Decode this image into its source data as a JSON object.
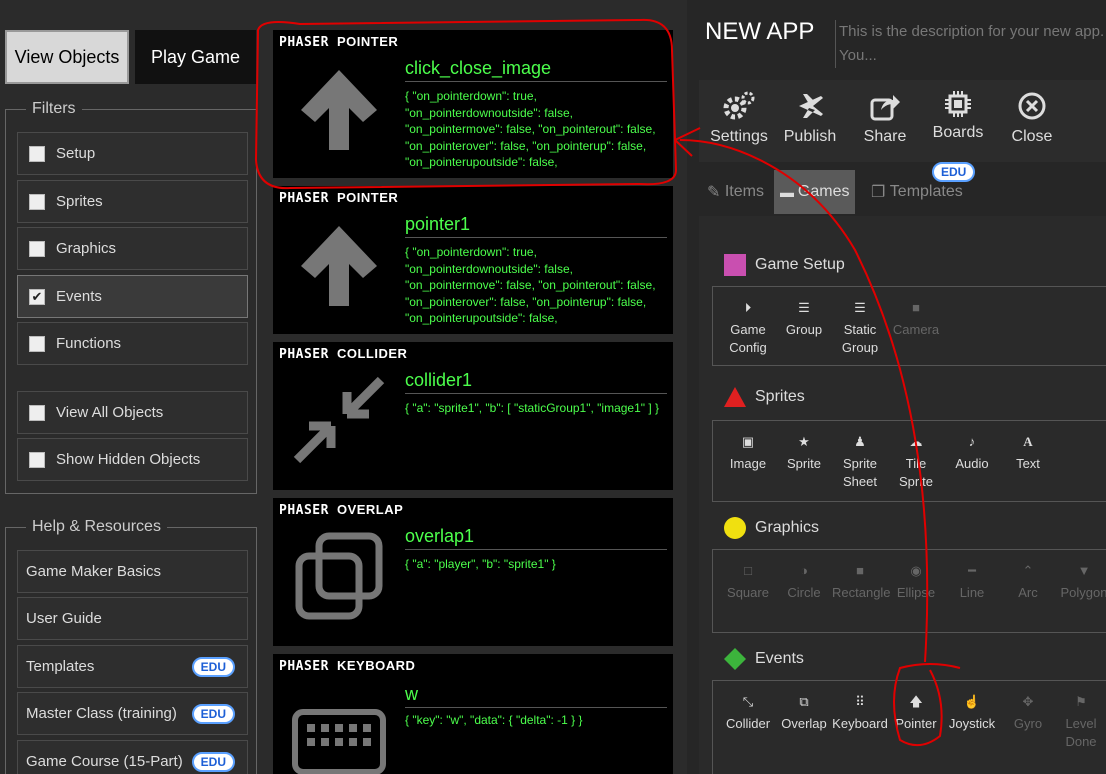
{
  "left": {
    "view_objects": "View Objects",
    "play_game": "Play Game",
    "filters_legend": "Filters",
    "filters": [
      {
        "label": "Setup",
        "checked": false
      },
      {
        "label": "Sprites",
        "checked": false
      },
      {
        "label": "Graphics",
        "checked": false
      },
      {
        "label": "Events",
        "checked": true
      },
      {
        "label": "Functions",
        "checked": false
      }
    ],
    "view_all": "View All Objects",
    "show_hidden": "Show Hidden Objects",
    "help_legend": "Help & Resources",
    "help": [
      {
        "label": "Game Maker Basics",
        "badge": ""
      },
      {
        "label": "User Guide",
        "badge": ""
      },
      {
        "label": "Templates",
        "badge": "EDU"
      },
      {
        "label": "Master Class (training)",
        "badge": "EDU"
      },
      {
        "label": "Game Course (15-Part)",
        "badge": "EDU"
      }
    ],
    "check_mark": "✔"
  },
  "cards": [
    {
      "brand": "PHASER",
      "type": "POINTER",
      "icon": "arrow-up-icon",
      "name": "click_close_image",
      "props": "{ \"on_pointerdown\": true, \"on_pointerdownoutside\": false, \"on_pointermove\": false, \"on_pointerout\": false, \"on_pointerover\": false, \"on_pointerup\": false, \"on_pointerupoutside\": false,"
    },
    {
      "brand": "PHASER",
      "type": "POINTER",
      "icon": "arrow-up-icon",
      "name": "pointer1",
      "props": "{ \"on_pointerdown\": true, \"on_pointerdownoutside\": false, \"on_pointermove\": false, \"on_pointerout\": false, \"on_pointerover\": false, \"on_pointerup\": false, \"on_pointerupoutside\": false,"
    },
    {
      "brand": "PHASER",
      "type": "COLLIDER",
      "icon": "collide-arrows-icon",
      "name": "collider1",
      "props": "{ \"a\": \"sprite1\", \"b\": [ \"staticGroup1\", \"image1\" ] }"
    },
    {
      "brand": "PHASER",
      "type": "OVERLAP",
      "icon": "overlap-squares-icon",
      "name": "overlap1",
      "props": "{ \"a\": \"player\", \"b\": \"sprite1\" }"
    },
    {
      "brand": "PHASER",
      "type": "KEYBOARD",
      "icon": "keyboard-icon",
      "name": "w",
      "props": "{ \"key\": \"w\", \"data\": { \"delta\": -1 } }"
    }
  ],
  "right": {
    "app_title": "NEW APP",
    "app_desc": "This is the description for your new app. You...",
    "toolbar": [
      {
        "label": "Settings",
        "icon": "gears-icon"
      },
      {
        "label": "Publish",
        "icon": "plane-icon"
      },
      {
        "label": "Share",
        "icon": "share-icon"
      },
      {
        "label": "Boards",
        "icon": "chip-icon"
      },
      {
        "label": "Close",
        "icon": "close-circle-icon"
      }
    ],
    "tabs": [
      {
        "label": "Items",
        "icon": "edit-icon"
      },
      {
        "label": "Games",
        "icon": "gamepad-icon"
      },
      {
        "label": "Templates",
        "icon": "copy-icon"
      }
    ],
    "tabs_badge": "EDU",
    "sections": [
      {
        "title": "Game Setup",
        "color": "#c94fb0",
        "items": [
          {
            "label": "Game Config",
            "icon": "play-circle-icon",
            "disabled": false
          },
          {
            "label": "Group",
            "icon": "list-icon",
            "disabled": false
          },
          {
            "label": "Static Group",
            "icon": "list-icon",
            "disabled": false
          },
          {
            "label": "Camera",
            "icon": "camera-icon",
            "disabled": true
          }
        ]
      },
      {
        "title": "Sprites",
        "color": "#e02020",
        "items": [
          {
            "label": "Image",
            "icon": "picture-icon",
            "disabled": false
          },
          {
            "label": "Sprite",
            "icon": "star-icon",
            "disabled": false
          },
          {
            "label": "Sprite Sheet",
            "icon": "users-icon",
            "disabled": false
          },
          {
            "label": "Tile Sprite",
            "icon": "cloud-icon",
            "disabled": false
          },
          {
            "label": "Audio",
            "icon": "volume-icon",
            "disabled": false
          },
          {
            "label": "Text",
            "icon": "text-icon",
            "disabled": false
          }
        ]
      },
      {
        "title": "Graphics",
        "color": "#f0e010",
        "items": [
          {
            "label": "Square",
            "icon": "square-icon",
            "disabled": true
          },
          {
            "label": "Circle",
            "icon": "half-circle-icon",
            "disabled": true
          },
          {
            "label": "Rectangle",
            "icon": "square-filled-icon",
            "disabled": true
          },
          {
            "label": "Ellipse",
            "icon": "eye-icon",
            "disabled": true
          },
          {
            "label": "Line",
            "icon": "minus-icon",
            "disabled": true
          },
          {
            "label": "Arc",
            "icon": "chevron-up-icon",
            "disabled": true
          },
          {
            "label": "Polygon",
            "icon": "bookmark-icon",
            "disabled": true
          }
        ]
      },
      {
        "title": "Events",
        "color": "#3cb43c",
        "items": [
          {
            "label": "Collider",
            "icon": "collide-arrows-icon",
            "disabled": false
          },
          {
            "label": "Overlap",
            "icon": "overlap-squares-icon",
            "disabled": false
          },
          {
            "label": "Keyboard",
            "icon": "grid-icon",
            "disabled": false
          },
          {
            "label": "Pointer",
            "icon": "arrow-up-icon",
            "disabled": false
          },
          {
            "label": "Joystick",
            "icon": "hand-icon",
            "disabled": false
          },
          {
            "label": "Gyro",
            "icon": "move-icon",
            "disabled": true
          },
          {
            "label": "Level Done",
            "icon": "flag-icon",
            "disabled": true
          }
        ]
      }
    ]
  },
  "annotation_color": "#e00000"
}
